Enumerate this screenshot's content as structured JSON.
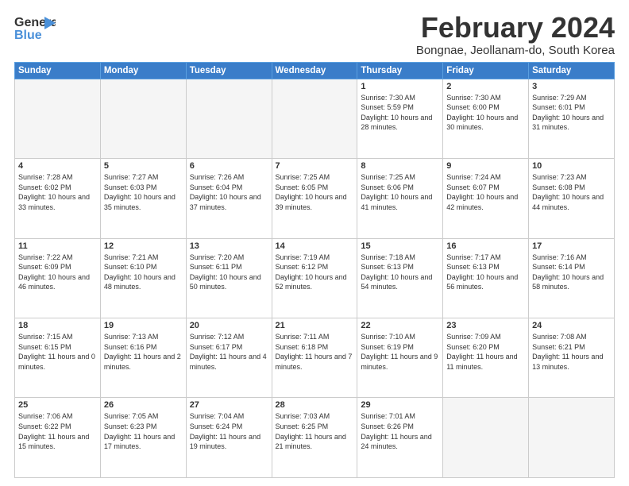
{
  "header": {
    "logo_line1": "General",
    "logo_line2": "Blue",
    "title": "February 2024",
    "location": "Bongnae, Jeollanam-do, South Korea"
  },
  "days_of_week": [
    "Sunday",
    "Monday",
    "Tuesday",
    "Wednesday",
    "Thursday",
    "Friday",
    "Saturday"
  ],
  "weeks": [
    [
      {
        "day": "",
        "info": ""
      },
      {
        "day": "",
        "info": ""
      },
      {
        "day": "",
        "info": ""
      },
      {
        "day": "",
        "info": ""
      },
      {
        "day": "1",
        "info": "Sunrise: 7:30 AM\nSunset: 5:59 PM\nDaylight: 10 hours and 28 minutes."
      },
      {
        "day": "2",
        "info": "Sunrise: 7:30 AM\nSunset: 6:00 PM\nDaylight: 10 hours and 30 minutes."
      },
      {
        "day": "3",
        "info": "Sunrise: 7:29 AM\nSunset: 6:01 PM\nDaylight: 10 hours and 31 minutes."
      }
    ],
    [
      {
        "day": "4",
        "info": "Sunrise: 7:28 AM\nSunset: 6:02 PM\nDaylight: 10 hours and 33 minutes."
      },
      {
        "day": "5",
        "info": "Sunrise: 7:27 AM\nSunset: 6:03 PM\nDaylight: 10 hours and 35 minutes."
      },
      {
        "day": "6",
        "info": "Sunrise: 7:26 AM\nSunset: 6:04 PM\nDaylight: 10 hours and 37 minutes."
      },
      {
        "day": "7",
        "info": "Sunrise: 7:25 AM\nSunset: 6:05 PM\nDaylight: 10 hours and 39 minutes."
      },
      {
        "day": "8",
        "info": "Sunrise: 7:25 AM\nSunset: 6:06 PM\nDaylight: 10 hours and 41 minutes."
      },
      {
        "day": "9",
        "info": "Sunrise: 7:24 AM\nSunset: 6:07 PM\nDaylight: 10 hours and 42 minutes."
      },
      {
        "day": "10",
        "info": "Sunrise: 7:23 AM\nSunset: 6:08 PM\nDaylight: 10 hours and 44 minutes."
      }
    ],
    [
      {
        "day": "11",
        "info": "Sunrise: 7:22 AM\nSunset: 6:09 PM\nDaylight: 10 hours and 46 minutes."
      },
      {
        "day": "12",
        "info": "Sunrise: 7:21 AM\nSunset: 6:10 PM\nDaylight: 10 hours and 48 minutes."
      },
      {
        "day": "13",
        "info": "Sunrise: 7:20 AM\nSunset: 6:11 PM\nDaylight: 10 hours and 50 minutes."
      },
      {
        "day": "14",
        "info": "Sunrise: 7:19 AM\nSunset: 6:12 PM\nDaylight: 10 hours and 52 minutes."
      },
      {
        "day": "15",
        "info": "Sunrise: 7:18 AM\nSunset: 6:13 PM\nDaylight: 10 hours and 54 minutes."
      },
      {
        "day": "16",
        "info": "Sunrise: 7:17 AM\nSunset: 6:13 PM\nDaylight: 10 hours and 56 minutes."
      },
      {
        "day": "17",
        "info": "Sunrise: 7:16 AM\nSunset: 6:14 PM\nDaylight: 10 hours and 58 minutes."
      }
    ],
    [
      {
        "day": "18",
        "info": "Sunrise: 7:15 AM\nSunset: 6:15 PM\nDaylight: 11 hours and 0 minutes."
      },
      {
        "day": "19",
        "info": "Sunrise: 7:13 AM\nSunset: 6:16 PM\nDaylight: 11 hours and 2 minutes."
      },
      {
        "day": "20",
        "info": "Sunrise: 7:12 AM\nSunset: 6:17 PM\nDaylight: 11 hours and 4 minutes."
      },
      {
        "day": "21",
        "info": "Sunrise: 7:11 AM\nSunset: 6:18 PM\nDaylight: 11 hours and 7 minutes."
      },
      {
        "day": "22",
        "info": "Sunrise: 7:10 AM\nSunset: 6:19 PM\nDaylight: 11 hours and 9 minutes."
      },
      {
        "day": "23",
        "info": "Sunrise: 7:09 AM\nSunset: 6:20 PM\nDaylight: 11 hours and 11 minutes."
      },
      {
        "day": "24",
        "info": "Sunrise: 7:08 AM\nSunset: 6:21 PM\nDaylight: 11 hours and 13 minutes."
      }
    ],
    [
      {
        "day": "25",
        "info": "Sunrise: 7:06 AM\nSunset: 6:22 PM\nDaylight: 11 hours and 15 minutes."
      },
      {
        "day": "26",
        "info": "Sunrise: 7:05 AM\nSunset: 6:23 PM\nDaylight: 11 hours and 17 minutes."
      },
      {
        "day": "27",
        "info": "Sunrise: 7:04 AM\nSunset: 6:24 PM\nDaylight: 11 hours and 19 minutes."
      },
      {
        "day": "28",
        "info": "Sunrise: 7:03 AM\nSunset: 6:25 PM\nDaylight: 11 hours and 21 minutes."
      },
      {
        "day": "29",
        "info": "Sunrise: 7:01 AM\nSunset: 6:26 PM\nDaylight: 11 hours and 24 minutes."
      },
      {
        "day": "",
        "info": ""
      },
      {
        "day": "",
        "info": ""
      }
    ]
  ]
}
